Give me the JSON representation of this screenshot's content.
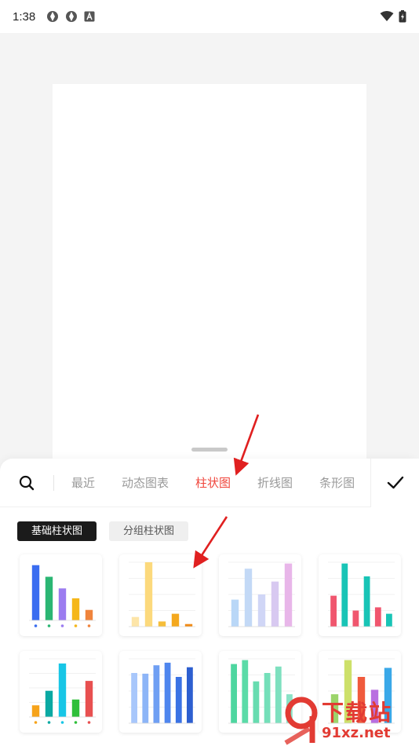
{
  "status_bar": {
    "time": "1:38",
    "left_icons": [
      "settings-gear-icon",
      "settings-gear-icon",
      "font-a-icon"
    ],
    "right_icons": [
      "wifi-icon",
      "battery-charging-icon"
    ]
  },
  "tabs": {
    "items": [
      "最近",
      "动态图表",
      "柱状图",
      "折线图",
      "条形图"
    ],
    "active_index": 2,
    "active_color": "#f0463c"
  },
  "subtabs": {
    "items": [
      "基础柱状图",
      "分组柱状图"
    ],
    "active_index": 0
  },
  "thumbnails": [
    {
      "name": "bar-thumbnail-colorful",
      "values": [
        0.95,
        0.75,
        0.55,
        0.38,
        0.18
      ],
      "colors": [
        "#3a6df0",
        "#2bb673",
        "#9b7cf0",
        "#f5b71a",
        "#f0843c"
      ],
      "legend_dots": true
    },
    {
      "name": "bar-thumbnail-yellow",
      "values": [
        0.15,
        1.0,
        0.08,
        0.2,
        0.04
      ],
      "colors": [
        "#fde5a8",
        "#fcd97c",
        "#f6be3a",
        "#f4a81d",
        "#f08a16"
      ],
      "gridlines": true
    },
    {
      "name": "bar-thumbnail-gradient-blue-pink",
      "values": [
        0.42,
        0.9,
        0.5,
        0.7,
        0.98
      ],
      "colors": [
        "#b9d7f7",
        "#c3d9f6",
        "#d0d6f6",
        "#d8c9f1",
        "#e8b6e9"
      ],
      "gridlines": true
    },
    {
      "name": "bar-thumbnail-teal-pink",
      "values": [
        0.48,
        0.98,
        0.25,
        0.78,
        0.3,
        0.2
      ],
      "colors": [
        "#f0566e",
        "#18c4b6",
        "#f0566e",
        "#18c4b6",
        "#f0566e",
        "#18c4b6"
      ],
      "gridlines": true
    },
    {
      "name": "bar-thumbnail-gradient-mixed",
      "values": [
        0.2,
        0.45,
        0.92,
        0.3,
        0.62
      ],
      "colors": [
        "#f6a31a",
        "#0aa9a3",
        "#18c6e6",
        "#2fbf3a",
        "#e85050"
      ],
      "gridlines": true,
      "legend_dots": true
    },
    {
      "name": "bar-thumbnail-blue",
      "values": [
        0.78,
        0.77,
        0.9,
        0.94,
        0.72,
        0.87
      ],
      "colors": [
        "#a8c7fb",
        "#8db5f7",
        "#6f9ff3",
        "#4f86ee",
        "#3a72e4",
        "#2d5fd0"
      ],
      "gridlines": true
    },
    {
      "name": "bar-thumbnail-green-gradient",
      "values": [
        0.92,
        0.98,
        0.65,
        0.78,
        0.88,
        0.45
      ],
      "colors": [
        "#4ed6a0",
        "#5bdba8",
        "#67dcb0",
        "#74dfb9",
        "#7ee0bf",
        "#8ae2c6"
      ],
      "gridlines": true
    },
    {
      "name": "bar-thumbnail-multicolor",
      "values": [
        0.45,
        0.98,
        0.72,
        0.52,
        0.86
      ],
      "colors": [
        "#9bd46a",
        "#cde06a",
        "#f05a3c",
        "#b96ee0",
        "#3aa8e8"
      ],
      "gridlines": true
    }
  ],
  "watermark": {
    "text_cn": "下载站",
    "text_url": "91xz.net"
  }
}
